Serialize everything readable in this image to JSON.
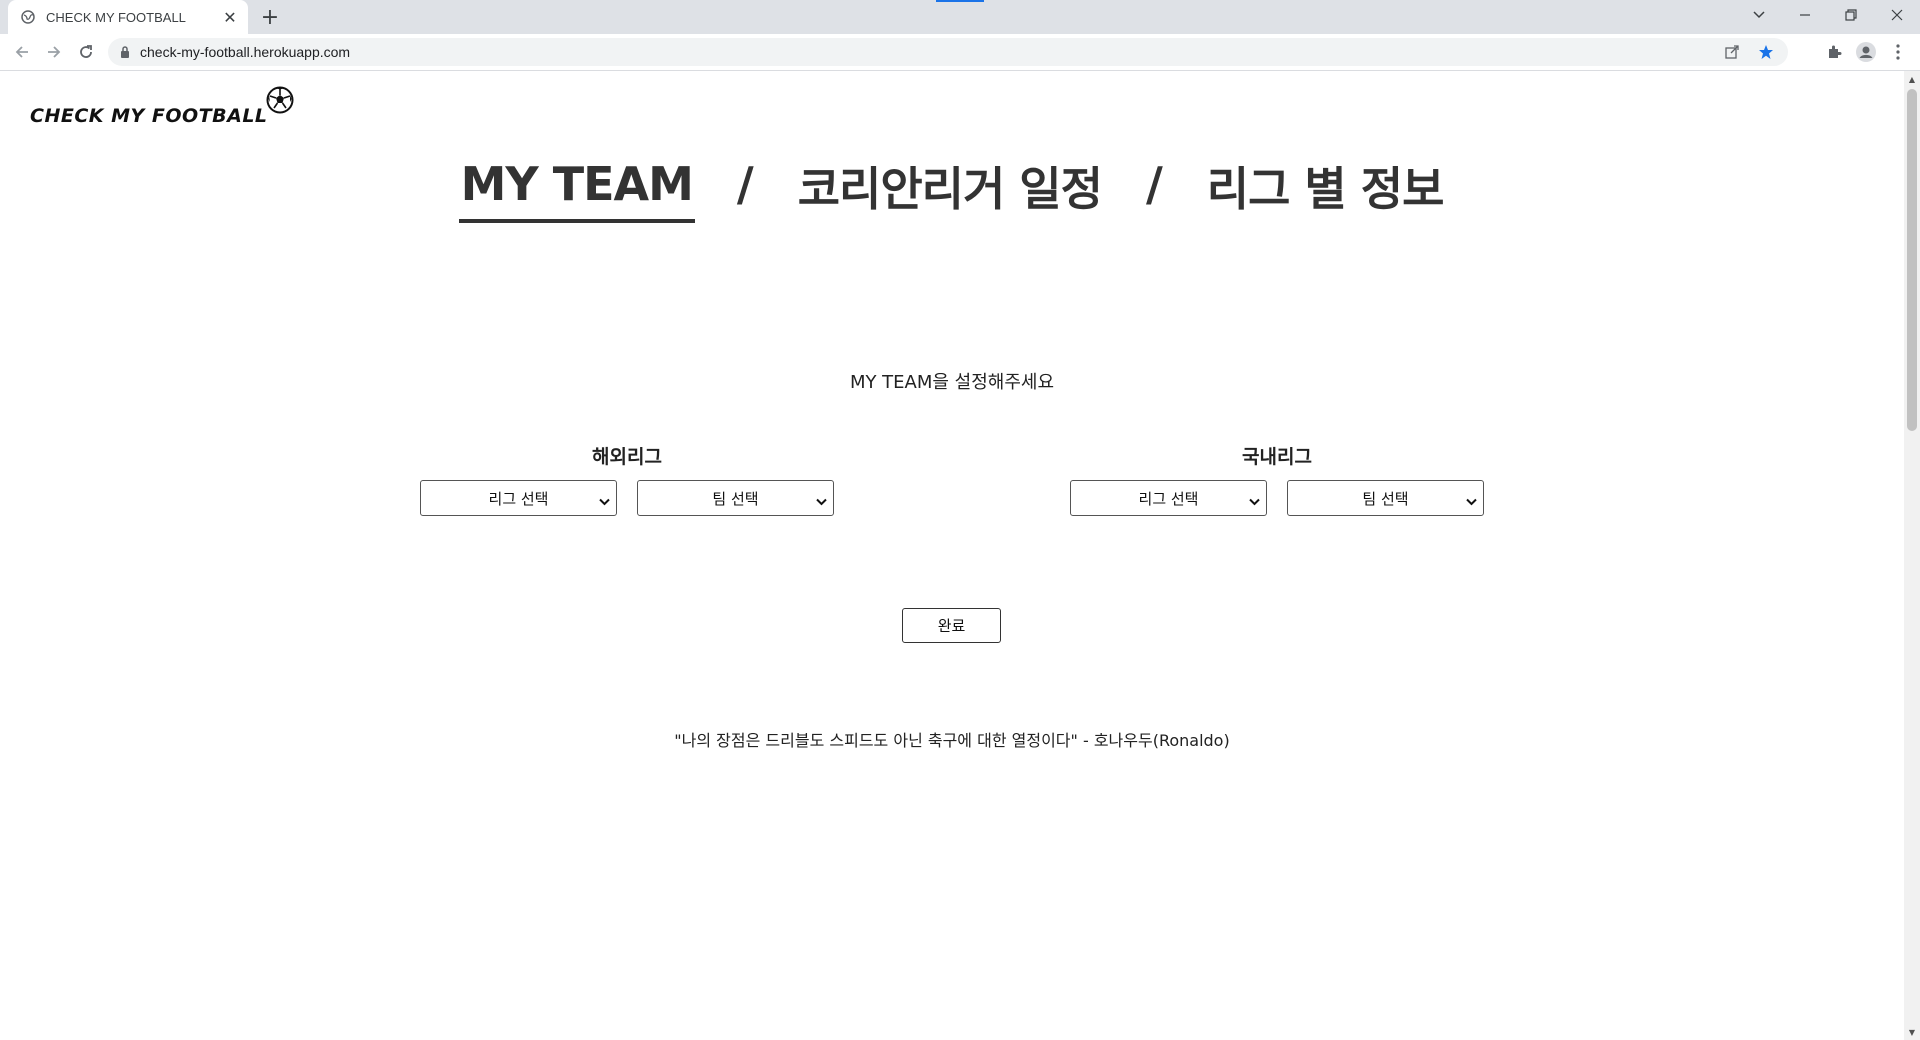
{
  "browser": {
    "tab_title": "CHECK MY FOOTBALL",
    "url": "check-my-football.herokuapp.com"
  },
  "site": {
    "logo_text": "CHECK MY FOOTBALL"
  },
  "nav": {
    "items": [
      "MY TEAM",
      "코리안리거 일정",
      "리그 별 정보"
    ],
    "separator": "/",
    "active_index": 0
  },
  "page": {
    "prompt": "MY TEAM을 설정해주세요",
    "groups": [
      {
        "title": "해외리그",
        "league_select": "리그 선택",
        "team_select": "팀 선택"
      },
      {
        "title": "국내리그",
        "league_select": "리그 선택",
        "team_select": "팀 선택"
      }
    ],
    "submit_label": "완료",
    "quote": "\"나의 장점은 드리블도 스피드도 아닌 축구에 대한 열정이다\" - 호나우두(Ronaldo)"
  },
  "colors": {
    "accent": "#1a73e8",
    "text": "#333333"
  }
}
